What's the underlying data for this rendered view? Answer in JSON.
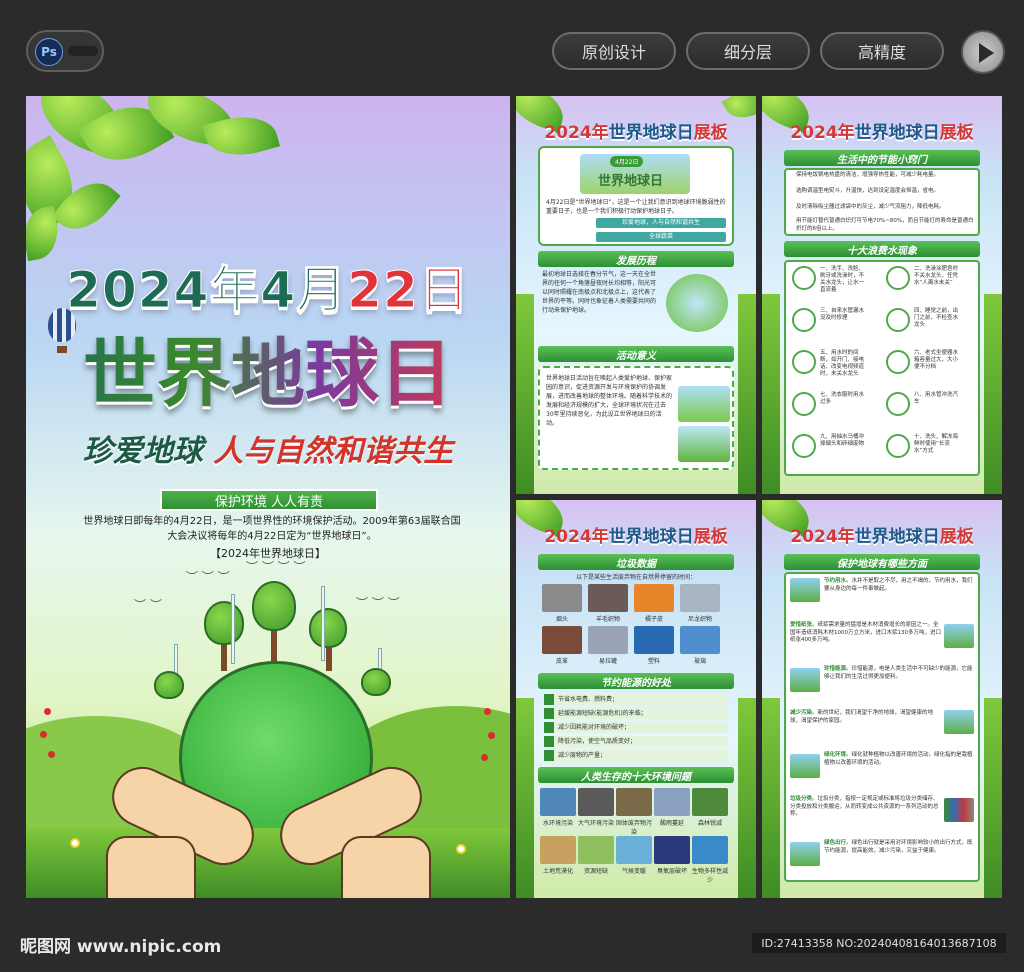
{
  "toolbar": {
    "app_icon": "ps-icon",
    "app_label": "Ps",
    "buttons": [
      "原创设计",
      "细分层",
      "高精度"
    ],
    "play_icon": "play-icon"
  },
  "main_poster": {
    "date_part1": "2024年4月",
    "date_part2": "22日",
    "title": "世界地球日",
    "slogan_part1": "珍爱地球 ",
    "slogan_part2": "人与自然和谐共生",
    "banner": "保护环境  人人有责",
    "intro": "世界地球日即每年的4月22日，是一项世界性的环境保护活动。2009年第63届联合国大会决议将每年的4月22日定为“世界地球日”。",
    "intro_tag": "【2024年世界地球日】"
  },
  "panel_title": {
    "year": "2024年",
    "rest": "世界地球日",
    "tail": "展板"
  },
  "panel1": {
    "card_date": "4月22日",
    "card_title": "世界地球日",
    "card_text": "4月22日是“世界地球日”，这是一个让我们意识到地球环境脆弱性的重要日子，也是一个我们积极行动保护地球日子。",
    "tags": [
      "珍爱地球，人与自然和谐共生",
      "全球蔬菜"
    ],
    "sec1": "发展历程",
    "sec1_text": "最初地球日选择在春分节气，这一天在全世界的任何一个角落昼夜时长均相等，阳光可以同时照耀在南极点和北极点上，这代表了世界的平等。同时也象征着人类需要共同的行动来保护地球。",
    "sec2": "活动意义",
    "sec2_text": "世界地球日活动旨在唤起人类爱护地球、保护家园的意识，促进资源开发与环境保护的协调发展，进而改善地球的整体环境。随着科学技术的发展和经济规模的扩大，全球环境状况在过去30年里持续恶化，为此设立世界地球日的活动。"
  },
  "panel2": {
    "sec1": "生活中的节能小窍门",
    "tips": [
      "保持电饭锅电热盘的清洁，增强导热性能，可减少耗电量。",
      "选购调温型电熨斗，升温快，达到设定温度会恒温，省电。",
      "及时清除吸尘器过滤袋中的灰尘，减少气流阻力，降低电耗。",
      "用节能灯替代普通白炽灯可节电70%~80%，而且节能灯的寿命是普通白炽灯的6倍以上。"
    ],
    "sec2": "十大浪费水现象",
    "waste": [
      "一、洗手、洗脸、刷牙或洗澡时，不关水龙头，让水一直流着",
      "二、洗澡涂肥皂时不关水龙头，任凭水“人离水未关”",
      "三、自来水管漏水没及时修理",
      "四、睡觉之前，出门之前，不检查水龙头",
      "五、用水时的间断，如开门、接电话、改变电视频道时，未关水龙头",
      "六、老式坐便器水箱容量过大，大小便不分档",
      "七、洗衣服时用水过多",
      "八、用水管冲洗汽车",
      "九、用抽水马桶冲掉烟头和碎细废物",
      "十、洗头、解冻海鲜时使用“长流水”方式"
    ]
  },
  "panel3": {
    "sec1": "垃圾数据",
    "intro": "以下是某些生活废弃物在自然界停留的时间：",
    "items": [
      "烟头",
      "羊毛织物",
      "橘子皮",
      "尼龙织物",
      "皮革",
      "易拉罐",
      "塑料",
      "玻璃"
    ],
    "sec2": "节约能源的好处",
    "benefits": [
      "节省水电费、燃料费；",
      "延缓能源短缺(能源危机)的来临；",
      "减少因耗能对环境的破坏；",
      "降低污染，使空气品质变好；",
      "减少废物的产量；"
    ],
    "sec3": "人类生存的十大环境问题",
    "problems": [
      "水环境污染",
      "大气环境污染",
      "固体废弃物污染",
      "酸雨蔓延",
      "森林锐减",
      "土地荒漠化",
      "资源短缺",
      "气候变暖",
      "臭氧层破坏",
      "生物多样性减少"
    ]
  },
  "panel4": {
    "sec1": "保护地球有哪些方面",
    "items": [
      {
        "head": "节约用水",
        "text": "水并不是取之不尽，用之不竭的，节约用水，我们要从身边的每一件事做起。"
      },
      {
        "head": "爱惜纸张",
        "text": "纸浆需求量的猛增是木材消费增长的原因之一。全国年造纸消耗木材1000万立方米，进口木浆130多万吨，进口纸张400多万吨。"
      },
      {
        "head": "珍惜能源",
        "text": "珍惜能源，电是人类生活中不可缺少的能源，它能够让我们的生活过得更加便利。"
      },
      {
        "head": "减少污染",
        "text": "新的世纪，我们渴望干净的地球，渴望健康的地球，渴望保护的家园。"
      },
      {
        "head": "绿化环境",
        "text": "绿化就种植物以改善环境的活动，绿化指的是栽植植物以改善环境的活动。"
      },
      {
        "head": "垃圾分类",
        "text": "垃圾分类，指按一定规定或标准将垃圾分类储存、分类投放和分类搬运，从而转变成公共资源的一系列活动的总称。"
      },
      {
        "head": "绿色出行",
        "text": "绿色出行就是采用对环境影响较小的出行方式，既节约能源，提高能效，减少污染，又益于健康。"
      }
    ]
  },
  "watermark": {
    "site": "昵图网 www.nipic.com",
    "id": "ID:27413358 NO:20240408164013687108"
  }
}
